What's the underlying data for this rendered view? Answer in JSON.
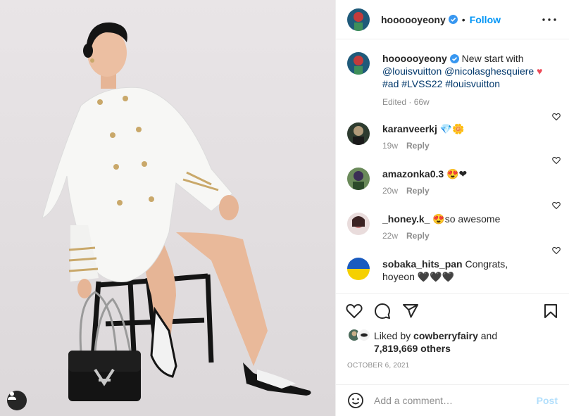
{
  "post": {
    "username": "hoooooyeony",
    "follow_label": "Follow",
    "dot": "•",
    "tag_icon": "user-icon"
  },
  "caption": {
    "username": "hoooooyeony",
    "text": "New start with",
    "tags_line1": "@louisvuitton @nicolasghesquiere",
    "heart": "♥",
    "tags_line2": "#ad #LVSS22 #louisvuitton",
    "edited": "Edited · 66w"
  },
  "comments": [
    {
      "user": "karanveerkj",
      "text": "💎🌼",
      "age": "19w",
      "reply": "Reply"
    },
    {
      "user": "amazonka0.3",
      "text": "😍❤",
      "age": "20w",
      "reply": "Reply"
    },
    {
      "user": "_honey.k_",
      "text": "😍so awesome",
      "age": "22w",
      "reply": "Reply"
    },
    {
      "user": "sobaka_hits_pan",
      "text": "Congrats, hoyeon 🖤🖤🖤",
      "age": "",
      "reply": ""
    }
  ],
  "likes": {
    "prefix": "Liked by",
    "user": "cowberryfairy",
    "and": "and",
    "count": "7,819,669 others"
  },
  "date": "OCTOBER 6, 2021",
  "add_comment": {
    "placeholder": "Add a comment…",
    "post_label": "Post"
  },
  "colors": {
    "follow": "#0095f6",
    "tag_link": "#00376b",
    "heart": "#ed4956",
    "post_disabled": "#b2dffc"
  }
}
